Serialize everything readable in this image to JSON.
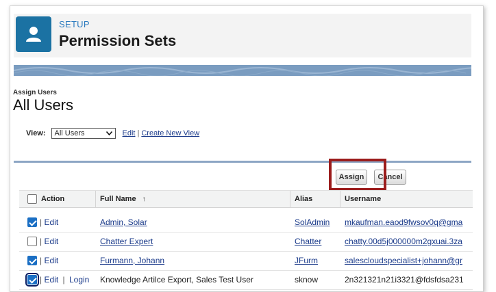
{
  "header": {
    "setup_label": "SETUP",
    "title": "Permission Sets",
    "icon": "user-icon"
  },
  "section": {
    "sub_label": "Assign Users",
    "title": "All Users"
  },
  "view": {
    "label": "View:",
    "selected": "All Users",
    "edit_link": "Edit",
    "separator": "|",
    "create_link": "Create New View"
  },
  "buttons": {
    "assign": "Assign",
    "cancel": "Cancel"
  },
  "table": {
    "headers": {
      "action": "Action",
      "full_name": "Full Name",
      "sort_indicator": "↑",
      "alias": "Alias",
      "username": "Username"
    },
    "rows": [
      {
        "checked": true,
        "action_sep": "|",
        "edit": "Edit",
        "login": "",
        "full_name": "Admin, Solar",
        "alias": "SolAdmin",
        "username": "mkaufman.eaod9fwsov0q@gma",
        "linked": true
      },
      {
        "checked": false,
        "action_sep": "|",
        "edit": "Edit",
        "login": "",
        "full_name": "Chatter Expert",
        "alias": "Chatter",
        "username": "chatty.00d5j000000m2gxuai.3za",
        "linked": true
      },
      {
        "checked": true,
        "action_sep": "|",
        "edit": "Edit",
        "login": "",
        "full_name": "Furmann, Johann",
        "alias": "JFurm",
        "username": "salescloudspecialist+johann@gr",
        "linked": true
      },
      {
        "checked": true,
        "action_sep": "|",
        "edit": "Edit",
        "login": "Login",
        "full_name": "Knowledge Artilce Export, Sales Test User",
        "alias": "sknow",
        "username": "2n321321n21i3321@fdsfdsa231",
        "linked": false
      }
    ]
  },
  "colors": {
    "accent": "#1b72a3",
    "checkbox": "#1b6fc4",
    "highlight": "#9b1c1c",
    "link": "#1a3a8a"
  }
}
